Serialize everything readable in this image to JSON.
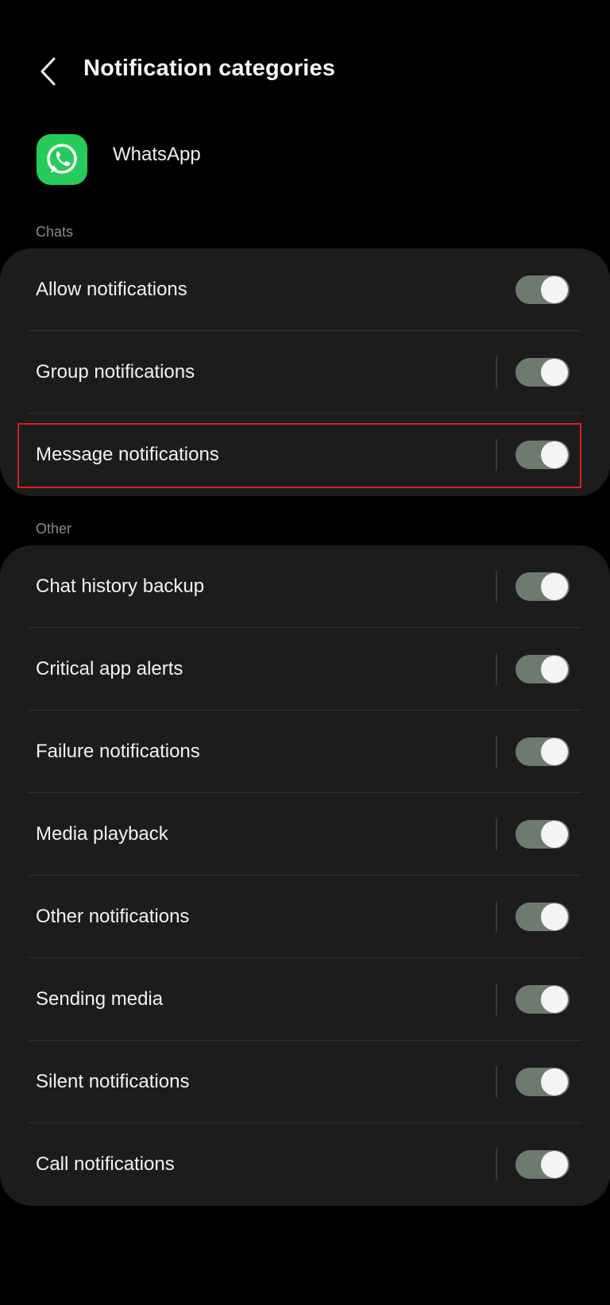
{
  "header": {
    "title": "Notification categories",
    "back_icon": "chevron-left-icon"
  },
  "app": {
    "name": "WhatsApp",
    "icon": "whatsapp-icon",
    "icon_color": "#25cc5a"
  },
  "sections": [
    {
      "label": "Chats",
      "items": [
        {
          "label": "Allow notifications",
          "on": true
        },
        {
          "label": "Group notifications",
          "on": true
        },
        {
          "label": "Message notifications",
          "on": true
        }
      ]
    },
    {
      "label": "Other",
      "items": [
        {
          "label": "Chat history backup",
          "on": true
        },
        {
          "label": "Critical app alerts",
          "on": true
        },
        {
          "label": "Failure notifications",
          "on": true
        },
        {
          "label": "Media playback",
          "on": true
        },
        {
          "label": "Other notifications",
          "on": true
        },
        {
          "label": "Sending media",
          "on": true
        },
        {
          "label": "Silent notifications",
          "on": true
        },
        {
          "label": "Call notifications",
          "on": true
        }
      ]
    }
  ],
  "colors": {
    "background": "#000000",
    "card": "#1c1c1c",
    "toggle_track_on": "#6d7a6e",
    "highlight": "#d32323"
  }
}
